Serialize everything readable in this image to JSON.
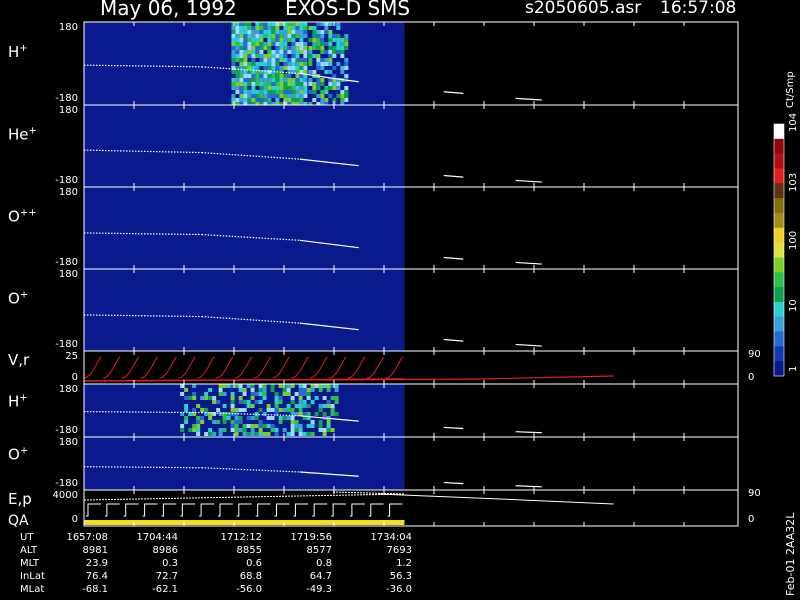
{
  "header": {
    "date": "May 06, 1992",
    "mission": "EXOS-D SMS",
    "file": "s2050605.asr",
    "time": "16:57:08"
  },
  "colorbar": {
    "units": "Ct/Smp",
    "labels": [
      "1",
      "10",
      "100",
      "10^3",
      "10^4"
    ],
    "colors": [
      "#0a1a8c",
      "#123ab4",
      "#2a6ad0",
      "#3aa0d8",
      "#2ad0d0",
      "#10a050",
      "#2ac04a",
      "#7ad02a",
      "#e0e040",
      "#f0d020",
      "#a09018",
      "#807010",
      "#603010",
      "#e02020",
      "#b01010",
      "#900808",
      "#ffffff"
    ]
  },
  "side_code": "Feb-01 2AA32L",
  "footer": {
    "row_labels": [
      "UT",
      "ALT",
      "MLT",
      "InLat",
      "MLat"
    ],
    "columns": [
      [
        "1657:08",
        "8981",
        "23.9",
        "76.4",
        "-68.1"
      ],
      [
        "1704:44",
        "8986",
        "0.3",
        "72.7",
        "-62.1"
      ],
      [
        "1712:12",
        "8855",
        "0.6",
        "68.8",
        "-56.0"
      ],
      [
        "1719:56",
        "8577",
        "0.8",
        "64.7",
        "-49.3"
      ],
      [
        "1734:04",
        "7693",
        "1.2",
        "56.3",
        "-36.0"
      ]
    ]
  },
  "chart_data": {
    "type": "heatmap",
    "title": "May 06, 1992   EXOS-D SMS",
    "panels": [
      {
        "label": "H",
        "sup": "+",
        "y_ticks": [
          "180",
          "-180"
        ],
        "ylim": [
          -180,
          180
        ],
        "activity": [
          [
            0.46,
            0.7,
            0.95
          ],
          [
            0.7,
            0.82,
            0.6
          ]
        ],
        "trace": [
          [
            0.0,
            0.52
          ],
          [
            0.18,
            0.54
          ],
          [
            0.33,
            0.62
          ],
          [
            0.4,
            0.7
          ],
          [
            0.42,
            0.72
          ],
          [
            0.48,
            0.78
          ],
          [
            0.55,
            0.84
          ],
          [
            0.58,
            0.86
          ],
          [
            0.66,
            0.92
          ],
          [
            0.7,
            0.94
          ],
          [
            0.81,
            0.98
          ]
        ]
      },
      {
        "label": "He",
        "sup": "+",
        "y_ticks": [
          "180",
          "-180"
        ],
        "ylim": [
          -180,
          180
        ],
        "activity": [],
        "trace": [
          [
            0.0,
            0.55
          ],
          [
            0.18,
            0.58
          ],
          [
            0.33,
            0.66
          ],
          [
            0.42,
            0.74
          ],
          [
            0.48,
            0.8
          ],
          [
            0.55,
            0.86
          ],
          [
            0.58,
            0.88
          ],
          [
            0.66,
            0.92
          ],
          [
            0.7,
            0.94
          ],
          [
            0.81,
            0.98
          ]
        ]
      },
      {
        "label": "O",
        "sup": "++",
        "y_ticks": [
          "180",
          "-180"
        ],
        "ylim": [
          -180,
          180
        ],
        "activity": [],
        "trace": [
          [
            0.0,
            0.56
          ],
          [
            0.18,
            0.58
          ],
          [
            0.33,
            0.65
          ],
          [
            0.42,
            0.74
          ],
          [
            0.48,
            0.8
          ],
          [
            0.55,
            0.86
          ],
          [
            0.58,
            0.88
          ],
          [
            0.66,
            0.92
          ],
          [
            0.7,
            0.94
          ],
          [
            0.81,
            0.98
          ]
        ]
      },
      {
        "label": "O",
        "sup": "+",
        "y_ticks": [
          "180",
          "-180"
        ],
        "ylim": [
          -180,
          180
        ],
        "activity": [],
        "trace": [
          [
            0.0,
            0.56
          ],
          [
            0.18,
            0.58
          ],
          [
            0.33,
            0.66
          ],
          [
            0.42,
            0.74
          ],
          [
            0.48,
            0.8
          ],
          [
            0.55,
            0.86
          ],
          [
            0.58,
            0.88
          ],
          [
            0.66,
            0.92
          ],
          [
            0.7,
            0.94
          ],
          [
            0.81,
            0.98
          ]
        ]
      },
      {
        "label": "V,r",
        "sup": "",
        "y_ticks": [
          "25",
          "0"
        ],
        "right_ticks": [
          "90",
          "0"
        ],
        "kind": "vr",
        "activity": []
      },
      {
        "label": "H",
        "sup": "+",
        "y_ticks": [
          "180",
          "-180"
        ],
        "ylim": [
          -180,
          180
        ],
        "activity": [
          [
            0.3,
            0.42,
            0.45
          ],
          [
            0.42,
            0.8,
            0.55
          ]
        ],
        "trace": [
          [
            0.0,
            0.52
          ],
          [
            0.18,
            0.54
          ],
          [
            0.33,
            0.6
          ],
          [
            0.42,
            0.7
          ],
          [
            0.48,
            0.76
          ],
          [
            0.55,
            0.82
          ],
          [
            0.58,
            0.84
          ],
          [
            0.66,
            0.9
          ],
          [
            0.7,
            0.92
          ],
          [
            0.81,
            0.98
          ]
        ]
      },
      {
        "label": "O",
        "sup": "+",
        "y_ticks": [
          "180",
          "-180"
        ],
        "ylim": [
          -180,
          180
        ],
        "activity": [],
        "trace": [
          [
            0.0,
            0.56
          ],
          [
            0.18,
            0.58
          ],
          [
            0.33,
            0.66
          ],
          [
            0.42,
            0.74
          ],
          [
            0.48,
            0.8
          ],
          [
            0.55,
            0.86
          ],
          [
            0.58,
            0.88
          ],
          [
            0.66,
            0.92
          ],
          [
            0.7,
            0.94
          ],
          [
            0.81,
            0.98
          ]
        ]
      },
      {
        "label": "E,p",
        "label2": "QA",
        "sup": "",
        "y_ticks": [
          "4000",
          "0"
        ],
        "right_ticks": [
          "90",
          "0"
        ],
        "kind": "ep",
        "activity": []
      }
    ],
    "x_ticks_ut": [
      "1657:08",
      "1704:44",
      "1712:12",
      "1719:56",
      "1734:04"
    ],
    "data_coverage_fraction": 0.49,
    "grid": false,
    "colors": {
      "field": "#0a1a8c",
      "trace": "#ffffff",
      "vr": "#e02020",
      "qa": "#f0e020"
    }
  }
}
